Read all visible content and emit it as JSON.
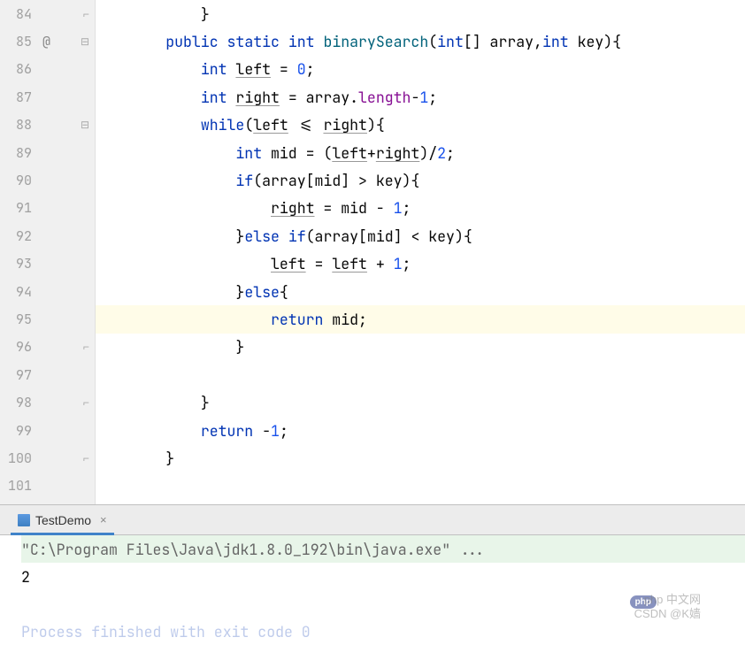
{
  "gutter": {
    "start": 84,
    "end": 101,
    "annotation_line": 85,
    "annotation_symbol": "@"
  },
  "fold_markers": {
    "84": "close",
    "85": "open",
    "86": "",
    "88": "open",
    "94": "",
    "95": "",
    "96": "close",
    "98": "close",
    "100": "close"
  },
  "code": {
    "l84": {
      "indent": "            ",
      "tokens": [
        [
          "txt",
          "}"
        ]
      ]
    },
    "l85": {
      "indent": "        ",
      "tokens": [
        [
          "kw",
          "public"
        ],
        [
          "txt",
          " "
        ],
        [
          "kw",
          "static"
        ],
        [
          "txt",
          " "
        ],
        [
          "type",
          "int"
        ],
        [
          "txt",
          " "
        ],
        [
          "fn",
          "binarySearch"
        ],
        [
          "txt",
          "("
        ],
        [
          "type",
          "int"
        ],
        [
          "txt",
          "[] array,"
        ],
        [
          "type",
          "int"
        ],
        [
          "txt",
          " key){"
        ]
      ]
    },
    "l86": {
      "indent": "            ",
      "tokens": [
        [
          "type",
          "int"
        ],
        [
          "txt",
          " "
        ],
        [
          "under",
          "left"
        ],
        [
          "txt",
          " = "
        ],
        [
          "num",
          "0"
        ],
        [
          "txt",
          ";"
        ]
      ]
    },
    "l87": {
      "indent": "            ",
      "tokens": [
        [
          "type",
          "int"
        ],
        [
          "txt",
          " "
        ],
        [
          "under",
          "right"
        ],
        [
          "txt",
          " = array."
        ],
        [
          "field",
          "length"
        ],
        [
          "txt",
          "-"
        ],
        [
          "num",
          "1"
        ],
        [
          "txt",
          ";"
        ]
      ]
    },
    "l88": {
      "indent": "            ",
      "tokens": [
        [
          "kw",
          "while"
        ],
        [
          "txt",
          "("
        ],
        [
          "under",
          "left"
        ],
        [
          "txt",
          " <= "
        ],
        [
          "under",
          "right"
        ],
        [
          "txt",
          "){"
        ]
      ]
    },
    "l89": {
      "indent": "                ",
      "tokens": [
        [
          "type",
          "int"
        ],
        [
          "txt",
          " mid = ("
        ],
        [
          "under",
          "left"
        ],
        [
          "txt",
          "+"
        ],
        [
          "under",
          "right"
        ],
        [
          "txt",
          ")/"
        ],
        [
          "num",
          "2"
        ],
        [
          "txt",
          ";"
        ]
      ]
    },
    "l90": {
      "indent": "                ",
      "tokens": [
        [
          "kw",
          "if"
        ],
        [
          "txt",
          "(array[mid] > key){"
        ]
      ]
    },
    "l91": {
      "indent": "                    ",
      "tokens": [
        [
          "under",
          "right"
        ],
        [
          "txt",
          " = mid - "
        ],
        [
          "num",
          "1"
        ],
        [
          "txt",
          ";"
        ]
      ]
    },
    "l92": {
      "indent": "                ",
      "tokens": [
        [
          "txt",
          "}"
        ],
        [
          "kw",
          "else"
        ],
        [
          "txt",
          " "
        ],
        [
          "kw",
          "if"
        ],
        [
          "txt",
          "(array[mid] < key){"
        ]
      ]
    },
    "l93": {
      "indent": "                    ",
      "tokens": [
        [
          "under",
          "left"
        ],
        [
          "txt",
          " = "
        ],
        [
          "under",
          "left"
        ],
        [
          "txt",
          " + "
        ],
        [
          "num",
          "1"
        ],
        [
          "txt",
          ";"
        ]
      ]
    },
    "l94": {
      "indent": "                ",
      "tokens": [
        [
          "txt",
          "}"
        ],
        [
          "kw",
          "else"
        ],
        [
          "txt",
          "{"
        ]
      ]
    },
    "l95": {
      "indent": "                    ",
      "tokens": [
        [
          "kw",
          "return"
        ],
        [
          "txt",
          " mid;"
        ]
      ],
      "highlight": true
    },
    "l96": {
      "indent": "                ",
      "tokens": [
        [
          "txt",
          "}"
        ]
      ]
    },
    "l97": {
      "indent": "",
      "tokens": []
    },
    "l98": {
      "indent": "            ",
      "tokens": [
        [
          "txt",
          "}"
        ]
      ]
    },
    "l99": {
      "indent": "            ",
      "tokens": [
        [
          "kw",
          "return"
        ],
        [
          "txt",
          " -"
        ],
        [
          "num",
          "1"
        ],
        [
          "txt",
          ";"
        ]
      ]
    },
    "l100": {
      "indent": "        ",
      "tokens": [
        [
          "txt",
          "}"
        ]
      ]
    },
    "l101": {
      "indent": "",
      "tokens": []
    }
  },
  "tab": {
    "label": "TestDemo"
  },
  "console": {
    "cmd": "\"C:\\Program Files\\Java\\jdk1.8.0_192\\bin\\java.exe\" ...",
    "output": "2",
    "exit": "Process finished with exit code 0"
  },
  "watermark": {
    "w1": "php 中文网",
    "w2": "CSDN @K嫱"
  }
}
